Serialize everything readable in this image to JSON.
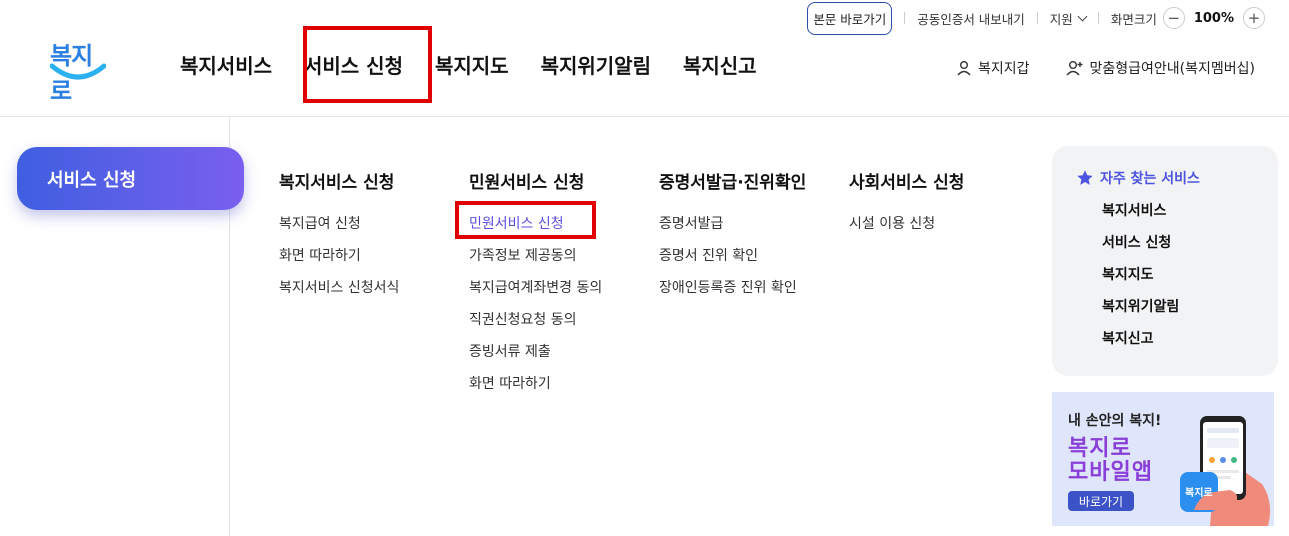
{
  "utility": {
    "skip_link": "본문 바로가기",
    "certificate": "공동인증서 내보내기",
    "support": "지원",
    "zoom_label": "화면크기",
    "zoom_minus": "−",
    "zoom_value": "100%",
    "zoom_plus": "+"
  },
  "logo": {
    "text": "복지로"
  },
  "gnb": {
    "items": [
      "복지서비스",
      "서비스 신청",
      "복지지도",
      "복지위기알림",
      "복지신고"
    ],
    "highlighted": "서비스 신청"
  },
  "member": {
    "wallet": "복지지갑",
    "membership": "맞춤형급여안내(복지멤버십)"
  },
  "sidebar": {
    "active": "서비스 신청"
  },
  "menu": {
    "columns": [
      {
        "title": "복지서비스 신청",
        "items": [
          "복지급여 신청",
          "화면 따라하기",
          "복지서비스 신청서식"
        ]
      },
      {
        "title": "민원서비스 신청",
        "items": [
          "민원서비스 신청",
          "가족정보 제공동의",
          "복지급여계좌변경 동의",
          "직권신청요청 동의",
          "증빙서류 제출",
          "화면 따라하기"
        ]
      },
      {
        "title": "증명서발급·진위확인",
        "items": [
          "증명서발급",
          "증명서 진위 확인",
          "장애인등록증 진위 확인"
        ]
      },
      {
        "title": "사회서비스 신청",
        "items": [
          "시설 이용 신청"
        ]
      }
    ],
    "active_item": "민원서비스 신청"
  },
  "favorites": {
    "title": "자주 찾는 서비스",
    "items": [
      "복지서비스",
      "서비스 신청",
      "복지지도",
      "복지위기알림",
      "복지신고"
    ]
  },
  "banner": {
    "line1": "내 손안의 복지!",
    "line2": "복지로",
    "line3": "모바일앱",
    "button": "바로가기",
    "phone_logo": "복지로"
  },
  "colors": {
    "accent": "#5b4fe0",
    "pill_start": "#3f5fe0",
    "pill_end": "#7a5ff0",
    "highlight_box": "#e00000",
    "banner_title": "#8a3fd8"
  }
}
